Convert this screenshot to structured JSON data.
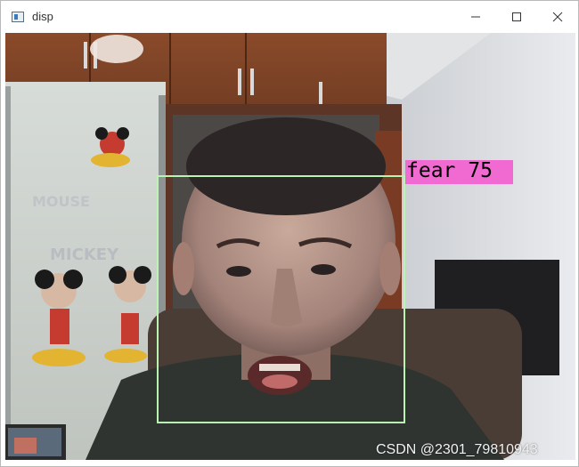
{
  "window": {
    "title": "disp"
  },
  "overlay": {
    "emotion_label": "fear 75",
    "box_color": "#b9f5b0",
    "label_color": "#f06ad2"
  },
  "watermark": "CSDN @2301_79810943",
  "icons": [
    "app-icon",
    "minimize-icon",
    "maximize-icon",
    "close-icon"
  ]
}
